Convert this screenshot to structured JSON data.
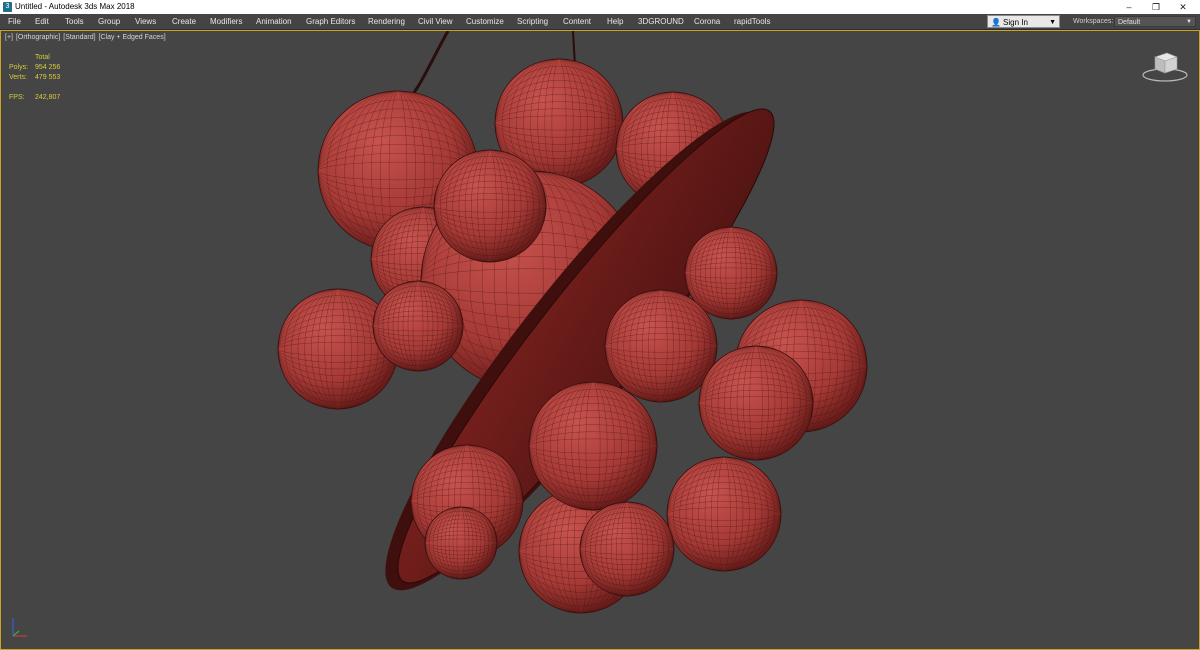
{
  "window": {
    "title": "Untitled - Autodesk 3ds Max 2018",
    "app_icon": "3ds-max-icon",
    "controls": [
      "–",
      "❐",
      "✕"
    ]
  },
  "menu": {
    "items": [
      "File",
      "Edit",
      "Tools",
      "Group",
      "Views",
      "Create",
      "Modifiers",
      "Animation",
      "Graph Editors",
      "Rendering",
      "Civil View",
      "Customize",
      "Scripting",
      "Content",
      "Help",
      "3DGROUND",
      "Corona",
      "rapidTools"
    ],
    "sign_in": "Sign In",
    "workspaces_label": "Workspaces:",
    "workspace_value": "Default"
  },
  "viewport": {
    "label": [
      "[+]",
      "[Orthographic]",
      "[Standard]",
      "[Clay + Edged Faces]"
    ],
    "stats": {
      "header": "Total",
      "polys_label": "Polys:",
      "polys_value": "954 256",
      "verts_label": "Verts:",
      "verts_value": "479 553",
      "fps_label": "FPS:",
      "fps_value": "242,807"
    },
    "colors": {
      "background": "#454545",
      "clay": "#b5433f",
      "wire": "#3a0f0e",
      "border": "#c9a527",
      "stats": "#d8cc3a"
    }
  }
}
